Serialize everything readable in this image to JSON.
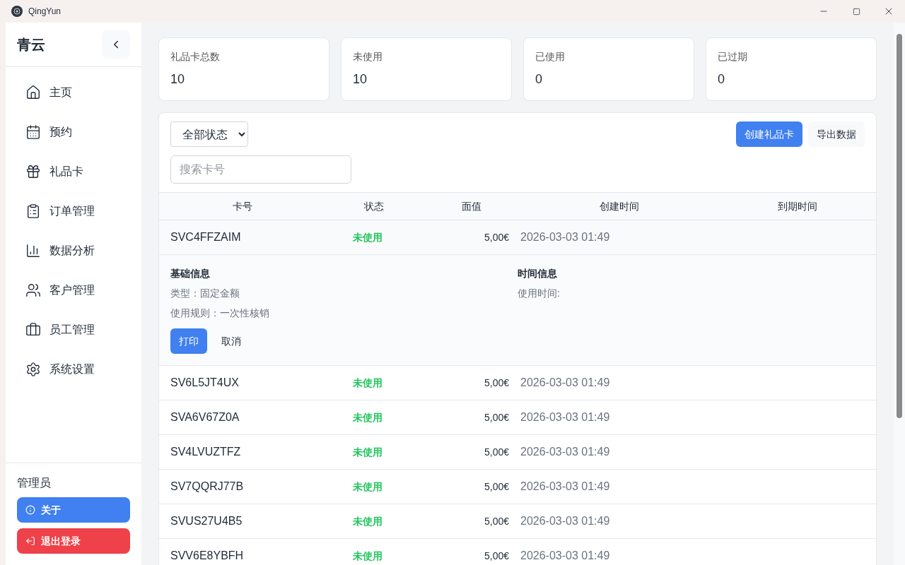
{
  "window": {
    "title": "QingYun"
  },
  "sidebar": {
    "brand": "青云",
    "items": [
      {
        "kind": "home",
        "label": "主页"
      },
      {
        "kind": "calendar",
        "label": "预约"
      },
      {
        "kind": "gift",
        "label": "礼品卡"
      },
      {
        "kind": "clipboard",
        "label": "订单管理"
      },
      {
        "kind": "chart",
        "label": "数据分析"
      },
      {
        "kind": "users",
        "label": "客户管理"
      },
      {
        "kind": "briefcase",
        "label": "员工管理"
      },
      {
        "kind": "settings",
        "label": "系统设置"
      }
    ],
    "user": "管理员",
    "about": "关于",
    "logout": "退出登录"
  },
  "stats": [
    {
      "label": "礼品卡总数",
      "value": "10"
    },
    {
      "label": "未使用",
      "value": "10"
    },
    {
      "label": "已使用",
      "value": "0"
    },
    {
      "label": "已过期",
      "value": "0"
    }
  ],
  "toolbar": {
    "filter": "全部状态",
    "search_placeholder": "搜索卡号",
    "create": "创建礼品卡",
    "export": "导出数据"
  },
  "table": {
    "columns": [
      "卡号",
      "状态",
      "面值",
      "创建时间",
      "到期时间"
    ],
    "rows": [
      {
        "card": "SVC4FFZAIM",
        "status": "未使用",
        "value": "5,00€",
        "created": "2026-03-03 01:49",
        "details": {
          "basic_title": "基础信息",
          "type": "类型：固定金额",
          "rule": "使用规则：一次性核销",
          "time_title": "时间信息",
          "used_time": "使用时间:",
          "print": "打印",
          "cancel": "取消"
        }
      },
      {
        "card": "SV6L5JT4UX",
        "status": "未使用",
        "value": "5,00€",
        "created": "2026-03-03 01:49"
      },
      {
        "card": "SVA6V67Z0A",
        "status": "未使用",
        "value": "5,00€",
        "created": "2026-03-03 01:49"
      },
      {
        "card": "SV4LVUZTFZ",
        "status": "未使用",
        "value": "5,00€",
        "created": "2026-03-03 01:49"
      },
      {
        "card": "SV7QQRJ77B",
        "status": "未使用",
        "value": "5,00€",
        "created": "2026-03-03 01:49"
      },
      {
        "card": "SVUS27U4B5",
        "status": "未使用",
        "value": "5,00€",
        "created": "2026-03-03 01:49"
      },
      {
        "card": "SVV6E8YBFH",
        "status": "未使用",
        "value": "5,00€",
        "created": "2026-03-03 01:49"
      }
    ]
  }
}
